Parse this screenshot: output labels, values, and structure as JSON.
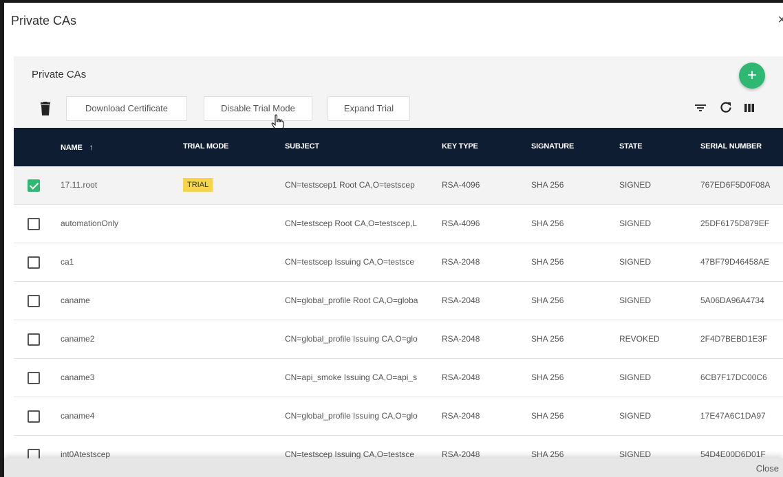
{
  "dialog": {
    "title": "Private CAs",
    "close_icon": "×",
    "footer_close_label": "Close"
  },
  "card": {
    "title": "Private CAs",
    "add_icon": "+",
    "toolbar": {
      "download_label": "Download Certificate",
      "disable_label": "Disable Trial Mode",
      "expand_label": "Expand Trial",
      "icons": [
        "trash-icon",
        "filter-icon",
        "refresh-icon",
        "columns-icon"
      ]
    }
  },
  "table": {
    "columns": {
      "name": "NAME",
      "trial_mode": "TRIAL MODE",
      "subject": "SUBJECT",
      "key_type": "KEY TYPE",
      "signature": "SIGNATURE",
      "state": "STATE",
      "serial_number": "SERIAL NUMBER"
    },
    "sort_arrow": "↑",
    "rows": [
      {
        "name": "17.11.root",
        "trial": "TRIAL",
        "subject": "CN=testscep1 Root CA,O=testscep",
        "key": "RSA-4096",
        "sig": "SHA 256",
        "state": "SIGNED",
        "serial": "767ED6F5D0F08A",
        "checked": true
      },
      {
        "name": "automationOnly",
        "trial": "",
        "subject": "CN=testscep Root CA,O=testscep,L",
        "key": "RSA-4096",
        "sig": "SHA 256",
        "state": "SIGNED",
        "serial": "25DF6175D879EF",
        "checked": false
      },
      {
        "name": "ca1",
        "trial": "",
        "subject": "CN=testscep Issuing CA,O=testsce",
        "key": "RSA-2048",
        "sig": "SHA 256",
        "state": "SIGNED",
        "serial": "47BF79D46458AE",
        "checked": false
      },
      {
        "name": "caname",
        "trial": "",
        "subject": "CN=global_profile Root CA,O=globa",
        "key": "RSA-2048",
        "sig": "SHA 256",
        "state": "SIGNED",
        "serial": "5A06DA96A4734",
        "checked": false
      },
      {
        "name": "caname2",
        "trial": "",
        "subject": "CN=global_profile Issuing CA,O=glo",
        "key": "RSA-2048",
        "sig": "SHA 256",
        "state": "REVOKED",
        "serial": "2F4D7BEBD1E3F",
        "checked": false
      },
      {
        "name": "caname3",
        "trial": "",
        "subject": "CN=api_smoke Issuing CA,O=api_s",
        "key": "RSA-2048",
        "sig": "SHA 256",
        "state": "SIGNED",
        "serial": "6CB7F17DC00C6",
        "checked": false
      },
      {
        "name": "caname4",
        "trial": "",
        "subject": "CN=global_profile Issuing CA,O=glo",
        "key": "RSA-2048",
        "sig": "SHA 256",
        "state": "SIGNED",
        "serial": "17E47A6C1DA97",
        "checked": false
      },
      {
        "name": "int0Atestscep",
        "trial": "",
        "subject": "CN=testscep Issuing CA,O=testsce",
        "key": "RSA-2048",
        "sig": "SHA 256",
        "state": "SIGNED",
        "serial": "54D4E00D6D01F",
        "checked": false
      }
    ]
  },
  "colors": {
    "header_bg": "#0f1d33",
    "accent_green": "#2eb872",
    "trial_badge": "#f7d54a"
  }
}
